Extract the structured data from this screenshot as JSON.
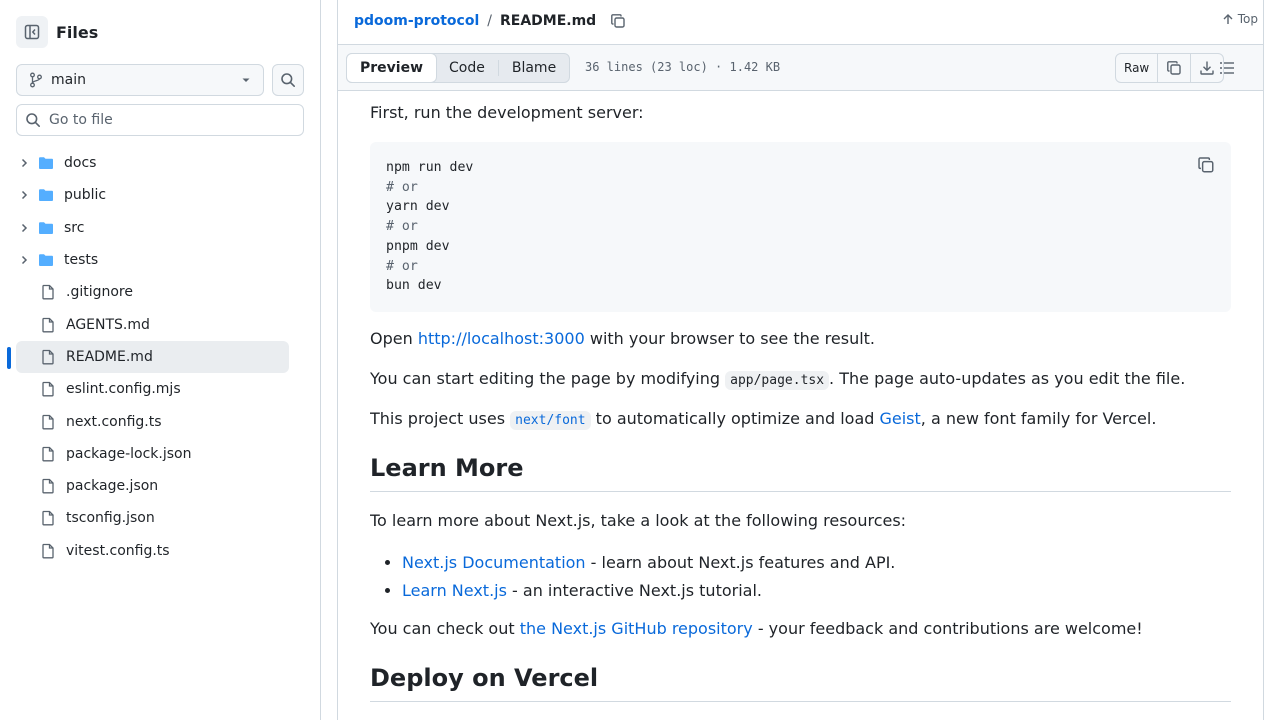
{
  "sidebar": {
    "title": "Files",
    "branch": "main",
    "goto_placeholder": "Go to file",
    "items": [
      {
        "type": "folder",
        "label": "docs"
      },
      {
        "type": "folder",
        "label": "public"
      },
      {
        "type": "folder",
        "label": "src"
      },
      {
        "type": "folder",
        "label": "tests"
      },
      {
        "type": "file",
        "label": ".gitignore"
      },
      {
        "type": "file",
        "label": "AGENTS.md"
      },
      {
        "type": "file",
        "label": "README.md",
        "selected": true
      },
      {
        "type": "file",
        "label": "eslint.config.mjs"
      },
      {
        "type": "file",
        "label": "next.config.ts"
      },
      {
        "type": "file",
        "label": "package-lock.json"
      },
      {
        "type": "file",
        "label": "package.json"
      },
      {
        "type": "file",
        "label": "tsconfig.json"
      },
      {
        "type": "file",
        "label": "vitest.config.ts"
      }
    ]
  },
  "header": {
    "repo": "pdoom-protocol",
    "separator": "/",
    "file": "README.md",
    "top_label": "Top"
  },
  "toolbar": {
    "tabs": [
      "Preview",
      "Code",
      "Blame"
    ],
    "active_tab": "Preview",
    "meta": "36 lines (23 loc) · 1.42 KB",
    "raw_label": "Raw"
  },
  "content": {
    "p1": "First, run the development server:",
    "code_lines": [
      {
        "text": "npm run dev",
        "comment": false
      },
      {
        "text": "# or",
        "comment": true
      },
      {
        "text": "yarn dev",
        "comment": false
      },
      {
        "text": "# or",
        "comment": true
      },
      {
        "text": "pnpm dev",
        "comment": false
      },
      {
        "text": "# or",
        "comment": true
      },
      {
        "text": "bun dev",
        "comment": false
      }
    ],
    "p2_pre": "Open ",
    "p2_link": "http://localhost:3000",
    "p2_post": " with your browser to see the result.",
    "p3_pre": "You can start editing the page by modifying ",
    "p3_code": "app/page.tsx",
    "p3_post": ". The page auto-updates as you edit the file.",
    "p4_pre": "This project uses ",
    "p4_code": "next/font",
    "p4_mid": " to automatically optimize and load ",
    "p4_link": "Geist",
    "p4_post": ", a new font family for Vercel.",
    "h2_learn": "Learn More",
    "p5": "To learn more about Next.js, take a look at the following resources:",
    "list": [
      {
        "link": "Next.js Documentation",
        "text": " - learn about Next.js features and API."
      },
      {
        "link": "Learn Next.js",
        "text": " - an interactive Next.js tutorial."
      }
    ],
    "p6_pre": "You can check out ",
    "p6_link": "the Next.js GitHub repository",
    "p6_post": " - your feedback and contributions are welcome!",
    "h2_deploy": "Deploy on Vercel"
  }
}
